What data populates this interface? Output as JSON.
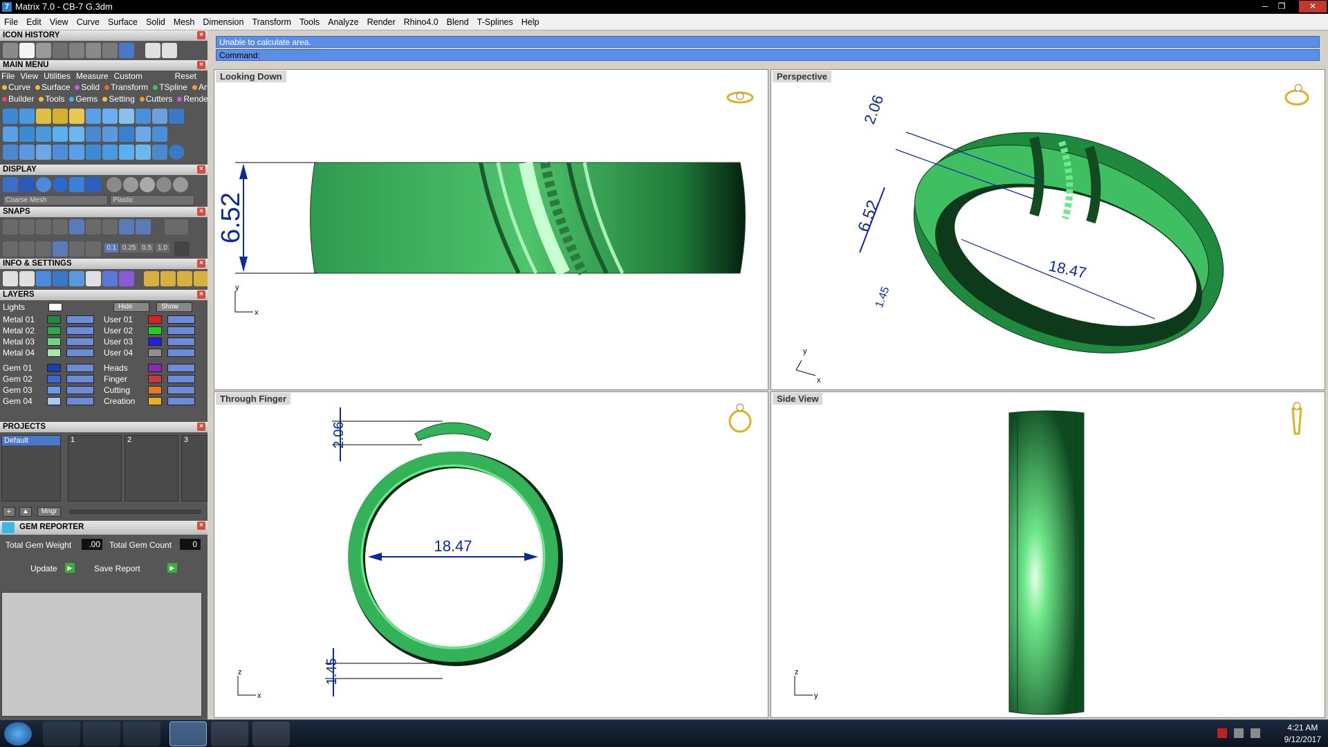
{
  "titlebar": {
    "title": "Matrix 7.0 - CB-7 G.3dm",
    "icon_glyph": "7",
    "min": "─",
    "max": "❐",
    "close": "✕"
  },
  "menubar": [
    "File",
    "Edit",
    "View",
    "Curve",
    "Surface",
    "Solid",
    "Mesh",
    "Dimension",
    "Transform",
    "Tools",
    "Analyze",
    "Render",
    "Rhino4.0",
    "Blend",
    "T-Splines",
    "Help"
  ],
  "panels": {
    "icon_history": "ICON HISTORY",
    "main_menu": "MAIN MENU",
    "main_menu_bar": [
      "File",
      "View",
      "Utilities",
      "Measure",
      "Custom"
    ],
    "main_menu_reset": "Reset",
    "main_menu_row1": [
      {
        "label": "Curve",
        "color": "#e8c23a"
      },
      {
        "label": "Surface",
        "color": "#e8c23a"
      },
      {
        "label": "Solid",
        "color": "#c060e0"
      },
      {
        "label": "Transform",
        "color": "#e86a3a"
      },
      {
        "label": "TSpline",
        "color": "#3ac06a"
      },
      {
        "label": "Art",
        "color": "#e8a03a"
      }
    ],
    "main_menu_row2": [
      {
        "label": "Builder",
        "color": "#e05050"
      },
      {
        "label": "Tools",
        "color": "#e8c23a"
      },
      {
        "label": "Gems",
        "color": "#3ab8e8"
      },
      {
        "label": "Setting",
        "color": "#e8c23a"
      },
      {
        "label": "Cutters",
        "color": "#e8a03a"
      },
      {
        "label": "Render",
        "color": "#c060e0"
      }
    ],
    "display": "DISPLAY",
    "display_combo1": "Coarse Mesh",
    "display_combo2": "Plastic",
    "snaps": "SNAPS",
    "snap_values": [
      "0.1",
      "0.25",
      "0.5",
      "1.0"
    ],
    "info_settings": "INFO & SETTINGS",
    "layers": "LAYERS",
    "lights": "Lights",
    "hide": "Hide",
    "show": "Show",
    "layers_left": [
      {
        "name": "Metal 01",
        "color": "#1d8a3c"
      },
      {
        "name": "Metal 02",
        "color": "#2ea84b"
      },
      {
        "name": "Metal 03",
        "color": "#6fd67a"
      },
      {
        "name": "Metal 04",
        "color": "#a8e8a8"
      },
      {
        "name": "Gem 01",
        "color": "#1a3fa8"
      },
      {
        "name": "Gem 02",
        "color": "#3a6ad8"
      },
      {
        "name": "Gem 03",
        "color": "#6a9ae8"
      },
      {
        "name": "Gem 04",
        "color": "#a8c8f0"
      }
    ],
    "layers_right": [
      {
        "name": "User 01",
        "color": "#e02020"
      },
      {
        "name": "User 02",
        "color": "#20d020"
      },
      {
        "name": "User 03",
        "color": "#2020e0"
      },
      {
        "name": "User 04",
        "color": "#909090"
      },
      {
        "name": "Heads",
        "color": "#8a2ab8"
      },
      {
        "name": "Finger",
        "color": "#c83a3a"
      },
      {
        "name": "Cutting",
        "color": "#e87a20"
      },
      {
        "name": "Creation",
        "color": "#e8b020"
      }
    ],
    "projects": "PROJECTS",
    "project_default": "Default",
    "project_slots": [
      "1",
      "2",
      "3"
    ],
    "project_mngr": "Mngr",
    "gem_reporter": "GEM REPORTER",
    "total_gem_weight_label": "Total Gem Weight",
    "total_gem_weight": ".00",
    "total_gem_count_label": "Total Gem Count",
    "total_gem_count": "0",
    "update": "Update",
    "save_report": "Save Report"
  },
  "command": {
    "message": "Unable to calculate area.",
    "prompt": "Command:"
  },
  "viewports": [
    {
      "label": "Looking Down",
      "dims": [
        "6.52"
      ],
      "axes": [
        "y",
        "x"
      ]
    },
    {
      "label": "Perspective",
      "dims": [
        "2.06",
        "6.52",
        "18.47",
        "1.45"
      ],
      "axes": [
        "y",
        "x"
      ]
    },
    {
      "label": "Through Finger",
      "dims": [
        "2.06",
        "18.47",
        "1.45"
      ],
      "axes": [
        "z",
        "x"
      ]
    },
    {
      "label": "Side View",
      "dims": [],
      "axes": [
        "z",
        "y"
      ]
    }
  ],
  "tray": {
    "time": "4:21 AM",
    "date": "9/12/2017"
  },
  "colors": {
    "ring_green": "#34b25a",
    "dim_blue": "#0a2a9a",
    "cmd_blue": "#5b8ee6"
  }
}
